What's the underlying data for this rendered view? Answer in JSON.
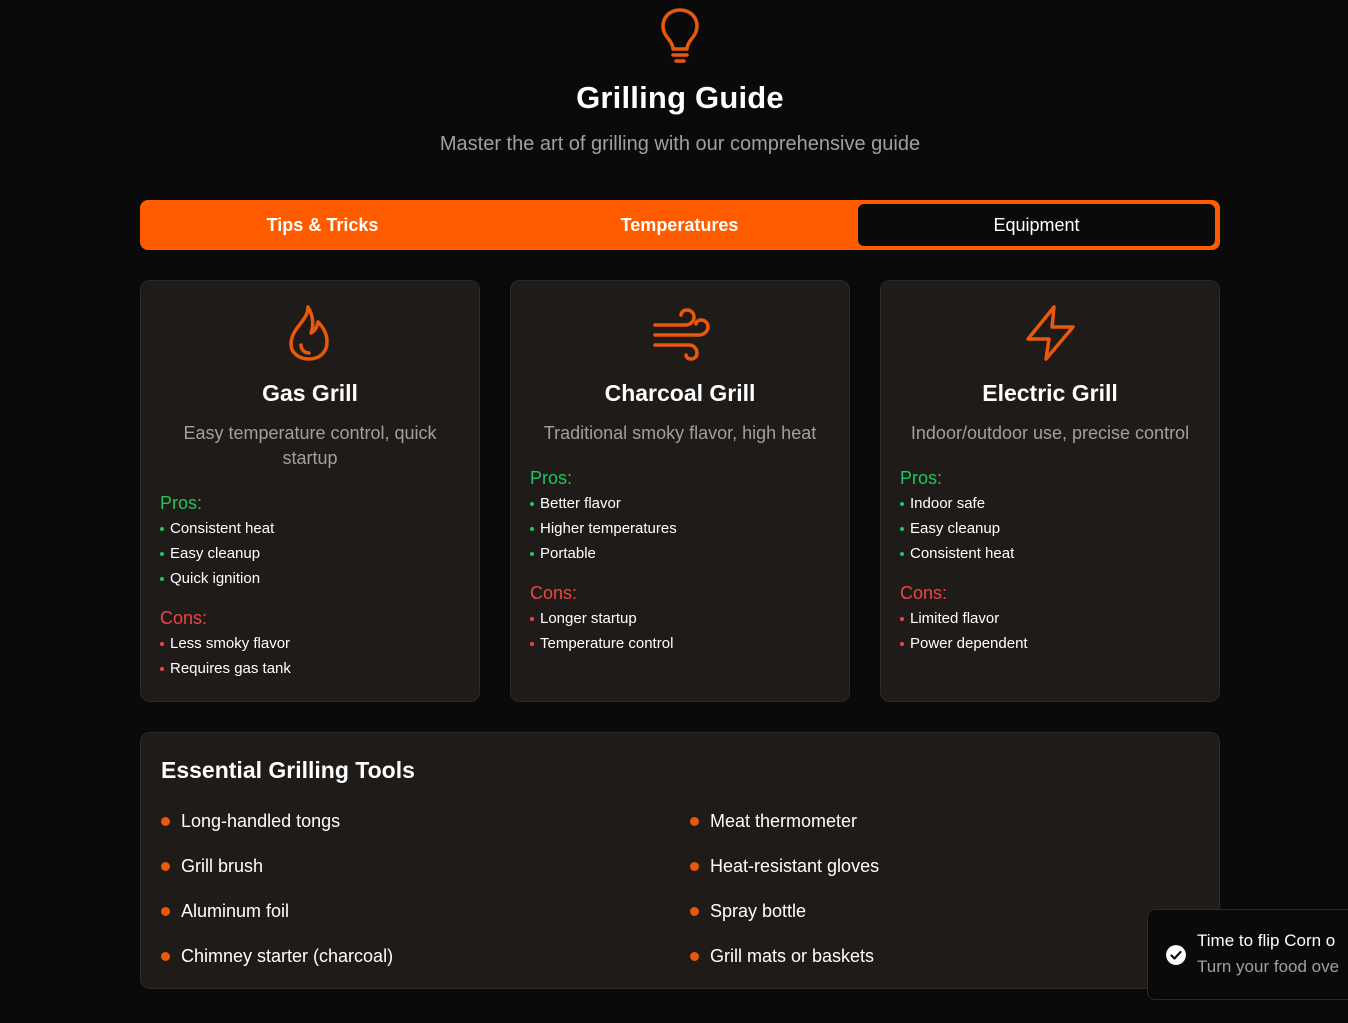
{
  "hero": {
    "icon": "lightbulb-icon",
    "title": "Grilling Guide",
    "subtitle": "Master the art of grilling with our comprehensive guide"
  },
  "tabs": [
    {
      "label": "Tips & Tricks",
      "active": false
    },
    {
      "label": "Temperatures",
      "active": false
    },
    {
      "label": "Equipment",
      "active": true
    }
  ],
  "colors": {
    "accent": "#ff5c00",
    "background": "#0b0a0a",
    "card": "#1f1b19",
    "pros": "#22c55e",
    "cons": "#ef4444"
  },
  "cards": [
    {
      "icon": "flame-icon",
      "title": "Gas Grill",
      "description": "Easy temperature control, quick startup",
      "pros_label": "Pros:",
      "pros": [
        "Consistent heat",
        "Easy cleanup",
        "Quick ignition"
      ],
      "cons_label": "Cons:",
      "cons": [
        "Less smoky flavor",
        "Requires gas tank"
      ]
    },
    {
      "icon": "wind-icon",
      "title": "Charcoal Grill",
      "description": "Traditional smoky flavor, high heat",
      "pros_label": "Pros:",
      "pros": [
        "Better flavor",
        "Higher temperatures",
        "Portable"
      ],
      "cons_label": "Cons:",
      "cons": [
        "Longer startup",
        "Temperature control"
      ]
    },
    {
      "icon": "lightning-icon",
      "title": "Electric Grill",
      "description": "Indoor/outdoor use, precise control",
      "pros_label": "Pros:",
      "pros": [
        "Indoor safe",
        "Easy cleanup",
        "Consistent heat"
      ],
      "cons_label": "Cons:",
      "cons": [
        "Limited flavor",
        "Power dependent"
      ]
    }
  ],
  "tools": {
    "title": "Essential Grilling Tools",
    "items": [
      "Long-handled tongs",
      "Meat thermometer",
      "Grill brush",
      "Heat-resistant gloves",
      "Aluminum foil",
      "Spray bottle",
      "Chimney starter (charcoal)",
      "Grill mats or baskets"
    ]
  },
  "toast": {
    "icon": "check-circle-icon",
    "title": "Time to flip Corn o",
    "description": "Turn your food ove"
  }
}
